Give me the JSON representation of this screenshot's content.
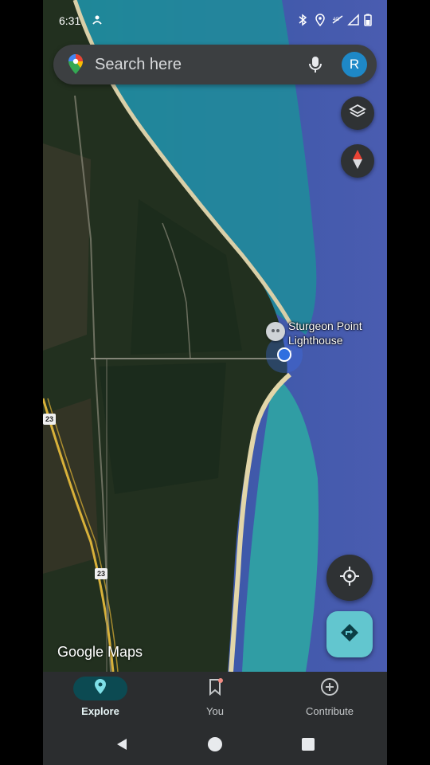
{
  "status_bar": {
    "time": "6:31",
    "icons": [
      "no-signal-person-icon",
      "bluetooth-icon",
      "location-icon",
      "signal-5g-icon",
      "wifi-signal-icon",
      "battery-icon"
    ]
  },
  "search": {
    "placeholder": "Search here",
    "avatar_letter": "R"
  },
  "map": {
    "poi_name_line1": "Sturgeon Point",
    "poi_name_line2": "Lighthouse",
    "route_shield_1": "23",
    "route_shield_2": "23",
    "watermark": "Google Maps"
  },
  "bottom_nav": {
    "items": [
      {
        "label": "Explore",
        "icon": "pin-icon",
        "active": true
      },
      {
        "label": "You",
        "icon": "bookmark-icon",
        "active": false
      },
      {
        "label": "Contribute",
        "icon": "add-circle-icon",
        "active": false
      }
    ]
  },
  "colors": {
    "accent": "#62c6cf",
    "avatar": "#1e88c7",
    "explore_active_bg": "#0c4a52",
    "search_bg": "#3c3f41"
  }
}
